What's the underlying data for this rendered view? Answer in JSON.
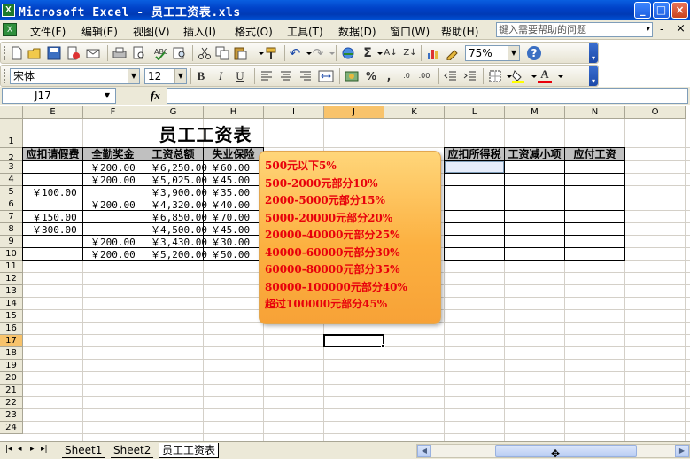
{
  "window": {
    "title": "Microsoft Excel - 员工工资表.xls",
    "app_icon": "X",
    "buttons": {
      "minimize": "_",
      "maximize": "□",
      "close": "×"
    }
  },
  "menu": {
    "doc_icon": "X",
    "items": [
      "文件(F)",
      "编辑(E)",
      "视图(V)",
      "插入(I)",
      "格式(O)",
      "工具(T)",
      "数据(D)",
      "窗口(W)",
      "帮助(H)"
    ],
    "help_placeholder": "键入需要帮助的问题",
    "help_arrow": "▾",
    "close_doc": "×",
    "restore_doc": "-"
  },
  "toolbar_standard": {
    "zoom": "75%",
    "icons": [
      "new-icon",
      "open-icon",
      "save-icon",
      "permission-icon",
      "email-icon",
      "print-icon",
      "print-preview-icon",
      "spelling-icon",
      "research-icon",
      "cut-icon",
      "copy-icon",
      "paste-icon",
      "format-painter-icon",
      "undo-icon",
      "redo-icon",
      "hyperlink-icon",
      "autosum-icon",
      "sort-ascending-icon",
      "sort-descending-icon",
      "chart-icon",
      "drawing-icon",
      "help-icon"
    ],
    "glyphs": {
      "autosum": "Σ",
      "sort_asc": "A↓",
      "sort_desc": "Z↓",
      "undo": "↶",
      "redo": "↷",
      "help": "?"
    }
  },
  "toolbar_format": {
    "font": "宋体",
    "size": "12",
    "bold": "B",
    "italic": "I",
    "underline": "U",
    "percent": "%",
    "comma": ",",
    "inc_decimal": ".0",
    "dec_decimal": ".00",
    "font_color_letter": "A"
  },
  "formula": {
    "namebox": "J17",
    "fx": "fx",
    "value": ""
  },
  "grid": {
    "columns": [
      "E",
      "F",
      "G",
      "H",
      "I",
      "J",
      "K",
      "L",
      "M",
      "N",
      "O"
    ],
    "selected_column": "J",
    "rows": [
      "1",
      "2",
      "3",
      "4",
      "5",
      "6",
      "7",
      "8",
      "9",
      "10",
      "11",
      "12",
      "13",
      "14",
      "15",
      "16",
      "17",
      "18",
      "19",
      "20",
      "21",
      "22",
      "23",
      "24"
    ],
    "selected_row": "17",
    "title": "员工工资表",
    "headers": [
      "应扣请假费",
      "全勤奖金",
      "工资总额",
      "失业保险",
      "应扣所得税",
      "工资减小项",
      "应付工资"
    ],
    "col_e": [
      "",
      "",
      "￥100.00",
      "",
      "￥150.00",
      "￥300.00",
      "",
      ""
    ],
    "col_f": [
      "￥200.00",
      "￥200.00",
      "",
      "￥200.00",
      "",
      "",
      "￥200.00",
      "￥200.00"
    ],
    "col_g": [
      "￥6,250.00",
      "￥5,025.00",
      "￥3,900.00",
      "￥4,320.00",
      "￥6,850.00",
      "￥4,500.00",
      "￥3,430.00",
      "￥5,200.00"
    ],
    "col_h": [
      "￥60.00",
      "￥45.00",
      "￥35.00",
      "￥40.00",
      "￥70.00",
      "￥45.00",
      "￥30.00",
      "￥50.00"
    ]
  },
  "comment": {
    "lines": [
      "500元以下5%",
      "500-2000元部分10%",
      "2000-5000元部分15%",
      "5000-20000元部分20%",
      "20000-40000元部分25%",
      "40000-60000元部分30%",
      "60000-80000元部分35%",
      "80000-100000元部分40%",
      "超过100000元部分45%"
    ]
  },
  "sheets": {
    "tabs": [
      "Sheet1",
      "Sheet2",
      "员工工资表"
    ],
    "active": "员工工资表",
    "nav": [
      "|◂",
      "◂",
      "▸",
      "▸|"
    ]
  }
}
